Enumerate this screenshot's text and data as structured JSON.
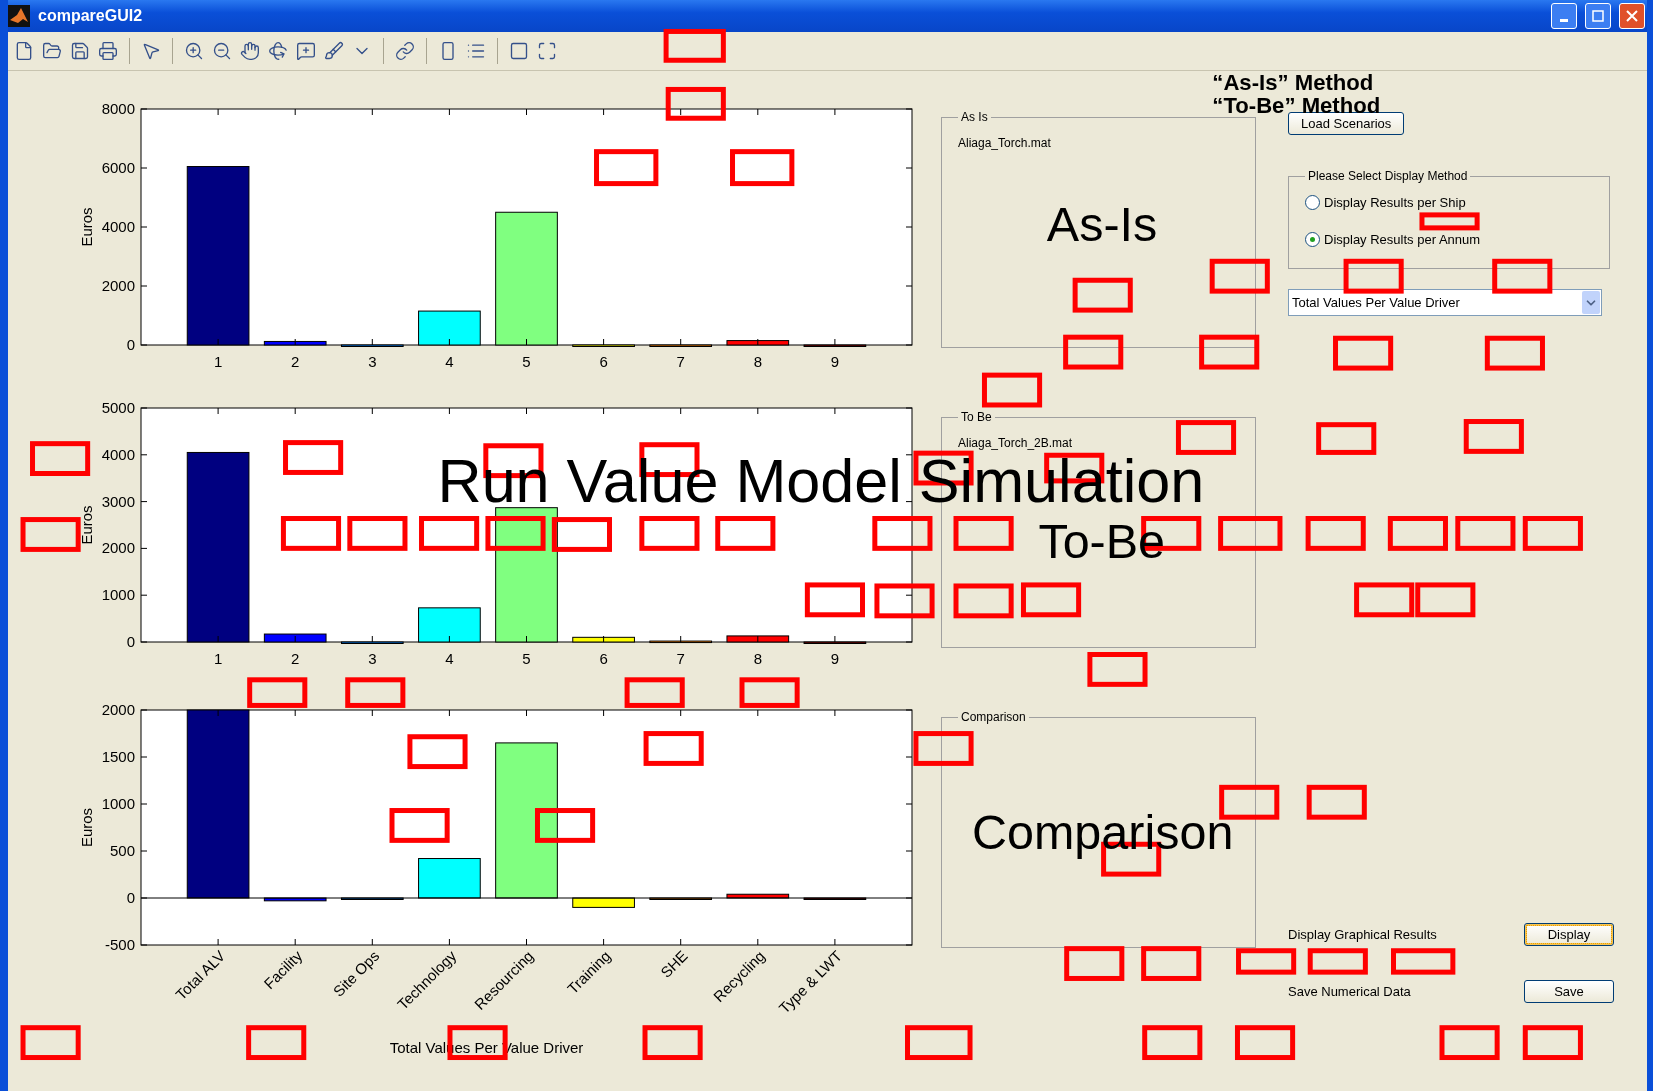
{
  "window": {
    "title": "compareGUI2"
  },
  "charts": [
    {
      "chart_data": {
        "type": "bar",
        "ylabel": "Euros",
        "categories": [
          "1",
          "2",
          "3",
          "4",
          "5",
          "6",
          "7",
          "8",
          "9"
        ],
        "stacked": true,
        "ylim": [
          0,
          8000
        ],
        "yticks": [
          0,
          2000,
          4000,
          6000,
          8000
        ],
        "series": [
          {
            "color": "#000080",
            "values": [
              6050,
              null,
              null,
              null,
              null,
              null,
              null,
              null,
              null
            ]
          },
          {
            "color": "#0000ff",
            "values": [
              null,
              120,
              null,
              null,
              null,
              null,
              null,
              null,
              null
            ]
          },
          {
            "color": "#0080ff",
            "values": [
              null,
              null,
              0,
              null,
              null,
              null,
              null,
              null,
              null
            ]
          },
          {
            "color": "#00ffff",
            "values": [
              null,
              null,
              null,
              1150,
              null,
              null,
              null,
              null,
              null
            ]
          },
          {
            "color": "#80ff80",
            "values": [
              null,
              null,
              null,
              null,
              4500,
              null,
              null,
              null,
              null
            ]
          },
          {
            "color": "#ffff00",
            "values": [
              null,
              null,
              null,
              null,
              null,
              0,
              null,
              null,
              null
            ]
          },
          {
            "color": "#ff8000",
            "values": [
              null,
              null,
              null,
              null,
              null,
              null,
              0,
              null,
              null
            ]
          },
          {
            "color": "#ff0000",
            "values": [
              null,
              null,
              null,
              null,
              null,
              null,
              null,
              150,
              null
            ]
          },
          {
            "color": "#800000",
            "values": [
              null,
              null,
              null,
              null,
              null,
              null,
              null,
              null,
              0
            ]
          }
        ]
      }
    },
    {
      "chart_data": {
        "type": "bar",
        "ylabel": "Euros",
        "categories": [
          "1",
          "2",
          "3",
          "4",
          "5",
          "6",
          "7",
          "8",
          "9"
        ],
        "stacked": true,
        "ylim": [
          0,
          5000
        ],
        "yticks": [
          0,
          1000,
          2000,
          3000,
          4000,
          5000
        ],
        "series": [
          {
            "color": "#000080",
            "values": [
              4050,
              null,
              null,
              null,
              null,
              null,
              null,
              null,
              null
            ]
          },
          {
            "color": "#0000ff",
            "values": [
              null,
              170,
              null,
              null,
              null,
              null,
              null,
              null,
              null
            ]
          },
          {
            "color": "#0080ff",
            "values": [
              null,
              null,
              0,
              null,
              null,
              null,
              null,
              null,
              null
            ]
          },
          {
            "color": "#00ffff",
            "values": [
              null,
              null,
              null,
              730,
              null,
              null,
              null,
              null,
              null
            ]
          },
          {
            "color": "#80ff80",
            "values": [
              null,
              null,
              null,
              null,
              2870,
              null,
              null,
              null,
              null
            ]
          },
          {
            "color": "#ffff00",
            "values": [
              null,
              null,
              null,
              null,
              null,
              100,
              null,
              null,
              null
            ]
          },
          {
            "color": "#ff8000",
            "values": [
              null,
              null,
              null,
              null,
              null,
              null,
              20,
              null,
              null
            ]
          },
          {
            "color": "#ff0000",
            "values": [
              null,
              null,
              null,
              null,
              null,
              null,
              null,
              130,
              null
            ]
          },
          {
            "color": "#800000",
            "values": [
              null,
              null,
              null,
              null,
              null,
              null,
              null,
              null,
              0
            ]
          }
        ]
      }
    },
    {
      "chart_data": {
        "type": "bar",
        "ylabel": "Euros",
        "xlabel": "Total Values Per Value Driver",
        "categories": [
          "Total ALV",
          "Facility",
          "Site Ops",
          "Technology",
          "Resourcing",
          "Training",
          "SHE",
          "Recycling",
          "Type & LWT"
        ],
        "stacked": true,
        "ylim": [
          -500,
          2000
        ],
        "yticks": [
          -500,
          0,
          500,
          1000,
          1500,
          2000
        ],
        "series": [
          {
            "color": "#000080",
            "values": [
              2000,
              null,
              null,
              null,
              null,
              null,
              null,
              null,
              null
            ]
          },
          {
            "color": "#0000ff",
            "values": [
              null,
              -30,
              null,
              null,
              null,
              null,
              null,
              null,
              null
            ]
          },
          {
            "color": "#0080ff",
            "values": [
              null,
              null,
              0,
              null,
              null,
              null,
              null,
              null,
              null
            ]
          },
          {
            "color": "#00ffff",
            "values": [
              null,
              null,
              null,
              420,
              null,
              null,
              null,
              null,
              null
            ]
          },
          {
            "color": "#80ff80",
            "values": [
              null,
              null,
              null,
              null,
              1650,
              null,
              null,
              null,
              null
            ]
          },
          {
            "color": "#ffff00",
            "values": [
              null,
              null,
              null,
              null,
              null,
              -100,
              null,
              null,
              null
            ]
          },
          {
            "color": "#ff8000",
            "values": [
              null,
              null,
              null,
              null,
              null,
              null,
              0,
              null,
              null
            ]
          },
          {
            "color": "#ff0000",
            "values": [
              null,
              null,
              null,
              null,
              null,
              null,
              null,
              40,
              null
            ]
          },
          {
            "color": "#800000",
            "values": [
              null,
              null,
              null,
              null,
              null,
              null,
              null,
              null,
              0
            ]
          }
        ]
      }
    }
  ],
  "panels": [
    {
      "title": "As Is",
      "file": "Aliaga_Torch.mat"
    },
    {
      "title": "To Be",
      "file": "Aliaga_Torch_2B.mat"
    },
    {
      "title": "Comparison"
    }
  ],
  "load_button": "Load Scenarios",
  "display_method": {
    "title": "Please Select Display Method",
    "options": [
      {
        "label": "Display Results per Ship",
        "selected": false
      },
      {
        "label": "Display Results per Annum",
        "selected": true
      }
    ]
  },
  "dropdown": {
    "value": "Total Values Per Value Driver"
  },
  "actions": [
    {
      "label": "Display Graphical Results",
      "button": "Display",
      "focused": true
    },
    {
      "label": "Save Numerical Data",
      "button": "Save",
      "focused": false
    }
  ],
  "overlay_labels": [
    "Run Value Model Simulation",
    "As-Is",
    "To-Be",
    "Comparison",
    "“As-Is” Method",
    "“To-Be” Method"
  ]
}
